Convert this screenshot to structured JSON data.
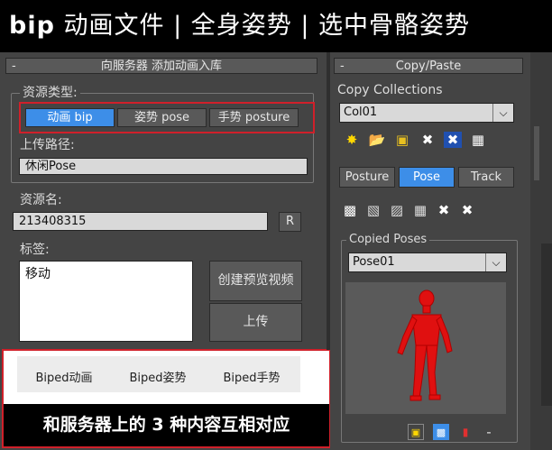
{
  "title": {
    "prefix": "bip",
    "rest": "动画文件 | 全身姿势 | 选中骨骼姿势"
  },
  "left_panel": {
    "header": "向服务器 添加动画入库",
    "collapse": "-",
    "resource_type_label": "资源类型:",
    "type_buttons": [
      "动画 bip",
      "姿势 pose",
      "手势 posture"
    ],
    "upload_path_label": "上传路径:",
    "upload_path_value": "休闲Pose",
    "resource_name_label": "资源名:",
    "resource_name_value": "213408315",
    "r_button": "R",
    "tags_label": "标签:",
    "tags_value": "移动",
    "preview_button": "创建预览视频",
    "upload_button": "上传"
  },
  "server_categories": [
    "Biped动画",
    "Biped姿势",
    "Biped手势"
  ],
  "caption": "和服务器上的 3 种内容互相对应",
  "copy_paste": {
    "header": "Copy/Paste",
    "collapse": "-",
    "collections_label": "Copy Collections",
    "collection_value": "Col01",
    "mode_tabs": [
      "Posture",
      "Pose",
      "Track"
    ],
    "active_tab": "Pose",
    "copied_poses_label": "Copied Poses",
    "pose_value": "Pose01",
    "bottom_minus": "-"
  },
  "colors": {
    "accent_blue": "#3d8ee8",
    "highlight_red": "#d0202a",
    "figure_red": "#e01010"
  }
}
